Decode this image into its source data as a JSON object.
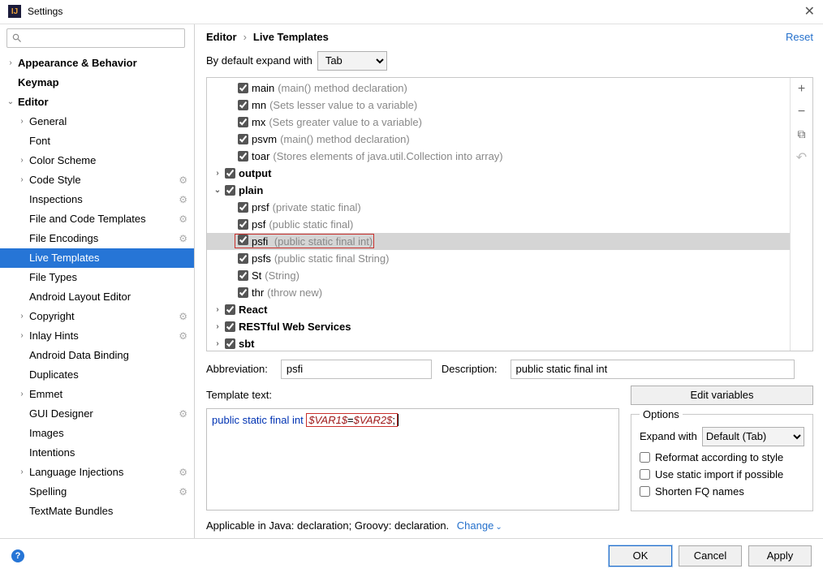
{
  "window": {
    "title": "Settings"
  },
  "breadcrumb": {
    "a": "Editor",
    "b": "Live Templates",
    "reset": "Reset"
  },
  "expand": {
    "label": "By default expand with",
    "value": "Tab"
  },
  "sidebar": [
    {
      "label": "Appearance & Behavior",
      "level": 0,
      "chev": "›",
      "bold": true
    },
    {
      "label": "Keymap",
      "level": 0,
      "chev": "",
      "bold": true
    },
    {
      "label": "Editor",
      "level": 0,
      "chev": "⌄",
      "bold": true
    },
    {
      "label": "General",
      "level": 1,
      "chev": "›"
    },
    {
      "label": "Font",
      "level": 1,
      "chev": ""
    },
    {
      "label": "Color Scheme",
      "level": 1,
      "chev": "›"
    },
    {
      "label": "Code Style",
      "level": 1,
      "chev": "›",
      "gear": true
    },
    {
      "label": "Inspections",
      "level": 1,
      "chev": "",
      "gear": true
    },
    {
      "label": "File and Code Templates",
      "level": 1,
      "chev": "",
      "gear": true
    },
    {
      "label": "File Encodings",
      "level": 1,
      "chev": "",
      "gear": true
    },
    {
      "label": "Live Templates",
      "level": 1,
      "chev": "",
      "selected": true
    },
    {
      "label": "File Types",
      "level": 1,
      "chev": ""
    },
    {
      "label": "Android Layout Editor",
      "level": 1,
      "chev": ""
    },
    {
      "label": "Copyright",
      "level": 1,
      "chev": "›",
      "gear": true
    },
    {
      "label": "Inlay Hints",
      "level": 1,
      "chev": "›",
      "gear": true
    },
    {
      "label": "Android Data Binding",
      "level": 1,
      "chev": ""
    },
    {
      "label": "Duplicates",
      "level": 1,
      "chev": ""
    },
    {
      "label": "Emmet",
      "level": 1,
      "chev": "›"
    },
    {
      "label": "GUI Designer",
      "level": 1,
      "chev": "",
      "gear": true
    },
    {
      "label": "Images",
      "level": 1,
      "chev": ""
    },
    {
      "label": "Intentions",
      "level": 1,
      "chev": ""
    },
    {
      "label": "Language Injections",
      "level": 1,
      "chev": "›",
      "gear": true
    },
    {
      "label": "Spelling",
      "level": 1,
      "chev": "",
      "gear": true
    },
    {
      "label": "TextMate Bundles",
      "level": 1,
      "chev": ""
    }
  ],
  "templates": [
    {
      "kind": "item",
      "name": "main",
      "desc": "(main() method declaration)"
    },
    {
      "kind": "item",
      "name": "mn",
      "desc": "(Sets lesser value to a variable)"
    },
    {
      "kind": "item",
      "name": "mx",
      "desc": "(Sets greater value to a variable)"
    },
    {
      "kind": "item",
      "name": "psvm",
      "desc": "(main() method declaration)"
    },
    {
      "kind": "item",
      "name": "toar",
      "desc": "(Stores elements of java.util.Collection into array)"
    },
    {
      "kind": "group",
      "name": "output",
      "chev": "›"
    },
    {
      "kind": "group",
      "name": "plain",
      "chev": "⌄"
    },
    {
      "kind": "item",
      "name": "prsf",
      "desc": "(private static final)"
    },
    {
      "kind": "item",
      "name": "psf",
      "desc": "(public static final)"
    },
    {
      "kind": "item",
      "name": "psfi",
      "desc": "(public static final int)",
      "selected": true,
      "highlight": true
    },
    {
      "kind": "item",
      "name": "psfs",
      "desc": "(public static final String)"
    },
    {
      "kind": "item",
      "name": "St",
      "desc": "(String)"
    },
    {
      "kind": "item",
      "name": "thr",
      "desc": "(throw new)"
    },
    {
      "kind": "group",
      "name": "React",
      "chev": "›"
    },
    {
      "kind": "group",
      "name": "RESTful Web Services",
      "chev": "›"
    },
    {
      "kind": "group",
      "name": "sbt",
      "chev": "›"
    }
  ],
  "fields": {
    "abbrev_label": "Abbreviation:",
    "abbrev_value": "psfi",
    "desc_label": "Description:",
    "desc_value": "public static final int",
    "template_label": "Template text:",
    "edit_vars": "Edit variables"
  },
  "code": {
    "prefix": "public static final int ",
    "var1": "$VAR1$",
    "eq": "=",
    "var2": "$VAR2$",
    "suffix": ";"
  },
  "options": {
    "title": "Options",
    "expand_label": "Expand with",
    "expand_value": "Default (Tab)",
    "reformat": "Reformat according to style",
    "static_import": "Use static import if possible",
    "shorten": "Shorten FQ names"
  },
  "applicable": {
    "text": "Applicable in Java: declaration; Groovy: declaration.",
    "change": "Change"
  },
  "footer": {
    "ok": "OK",
    "cancel": "Cancel",
    "apply": "Apply"
  }
}
